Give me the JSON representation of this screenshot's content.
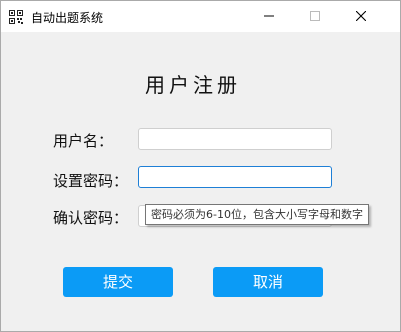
{
  "window": {
    "title": "自动出题系统",
    "controls": {
      "minimize": "minimize",
      "maximize": "maximize",
      "close": "close"
    }
  },
  "form": {
    "heading": "用户注册",
    "username_label": "用户名：",
    "username_value": "",
    "password_label": "设置密码：",
    "password_value": "",
    "confirm_label": "确认密码：",
    "confirm_value": "",
    "password_tooltip": "密码必须为6-10位，包含大小写字母和数字"
  },
  "buttons": {
    "submit": "提交",
    "cancel": "取消"
  },
  "colors": {
    "button_bg": "#0b9bf6",
    "button_text": "#ffffff",
    "focus_border": "#1e7fd6",
    "window_bg": "#f0f0f0"
  },
  "icons": {
    "app": "qr-code-icon",
    "minimize": "minimize-icon",
    "maximize": "maximize-icon",
    "close": "close-icon"
  }
}
